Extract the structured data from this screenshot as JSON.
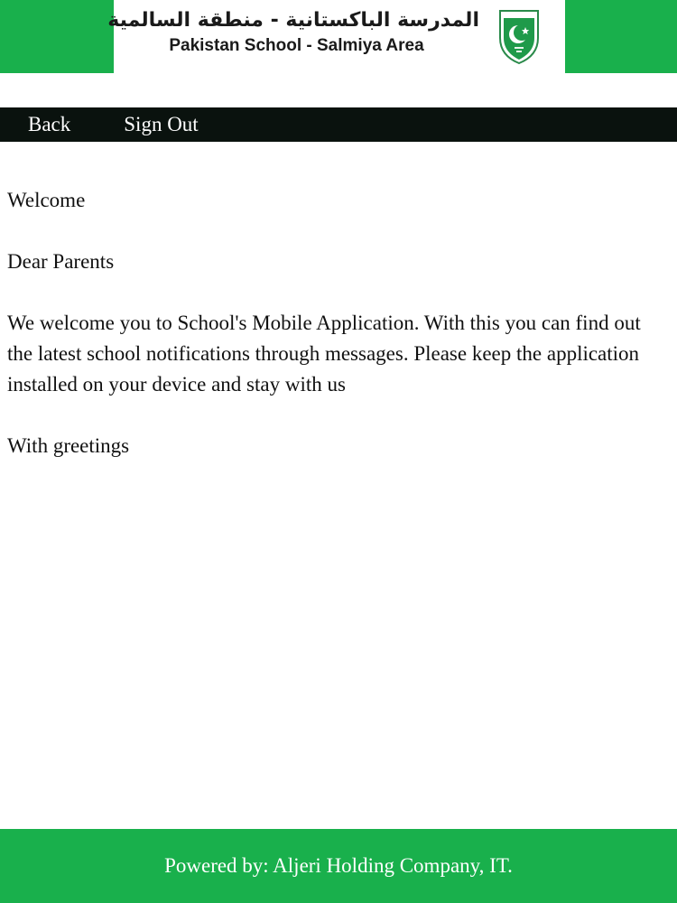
{
  "header": {
    "arabic_title": "المدرسة الباكستانية - منطقة السالمية",
    "english_title": "Pakistan School - Salmiya Area",
    "logo_icon": "pakistan-school-shield-icon",
    "colors": {
      "brand_green": "#19b04c",
      "nav_dark": "#0a120e"
    }
  },
  "nav": {
    "back_label": "Back",
    "signout_label": "Sign Out"
  },
  "content": {
    "greeting": "Welcome",
    "salutation": "Dear Parents",
    "message": "We welcome you to School's Mobile Application. With this you can find out the latest school notifications through messages. Please keep the application installed on your device and stay with us",
    "closing": "With greetings"
  },
  "footer": {
    "powered_by": "Powered by: Aljeri Holding Company, IT."
  }
}
